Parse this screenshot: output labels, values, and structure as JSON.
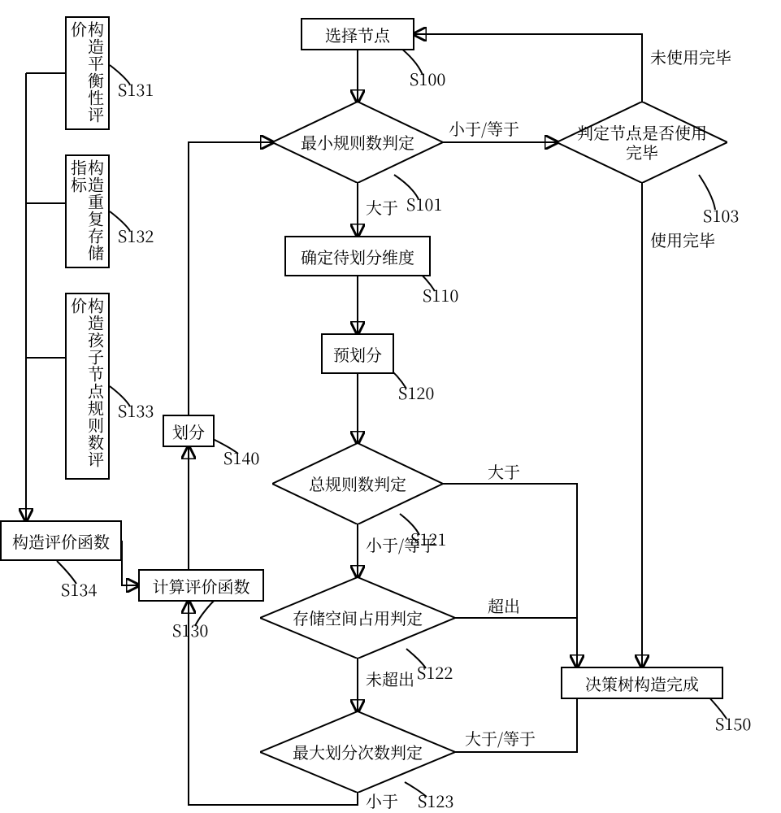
{
  "nodes": {
    "s100": "选择节点",
    "s101": "最小规则数判定",
    "s110": "确定待划分维度",
    "s120": "预划分",
    "s121": "总规则数判定",
    "s122": "存储空间占用判定",
    "s123": "最大划分次数判定",
    "s130": "计算评价函数",
    "s140": "划分",
    "s131": "构造平衡性评价",
    "s132": "构造重复存储指标",
    "s133": "构造孩子节点规则数评价",
    "s134": "构造评价函数",
    "s103": "判定节点是否使用完毕",
    "s150": "决策树构造完成"
  },
  "step_tags": {
    "s100": "S100",
    "s101": "S101",
    "s103": "S103",
    "s110": "S110",
    "s120": "S120",
    "s121": "S121",
    "s122": "S122",
    "s123": "S123",
    "s130": "S130",
    "s131": "S131",
    "s132": "S132",
    "s133": "S133",
    "s134": "S134",
    "s140": "S140",
    "s150": "S150"
  },
  "edge_labels": {
    "gt": "大于",
    "lt_eq": "小于/等于",
    "lt": "小于",
    "gt_eq": "大于/等于",
    "exceed": "超出",
    "not_exceed": "未超出",
    "used_done": "使用完毕",
    "not_used": "未使用完毕"
  }
}
